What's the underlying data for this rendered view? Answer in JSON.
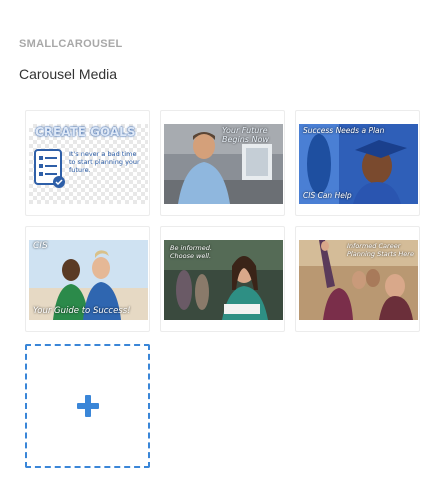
{
  "header": {
    "section_label": "SMALLCAROUSEL",
    "title": "Carousel Media"
  },
  "media_items": [
    {
      "name": "create-goals",
      "caption_main": "CREATE GOALS",
      "caption_sub": "It's never a bad time to start planning your future."
    },
    {
      "name": "your-future-begins-now",
      "caption_main": "Your Future Begins Now"
    },
    {
      "name": "success-needs-a-plan",
      "caption_main": "Success Needs a Plan",
      "caption_sub": "CIS Can Help"
    },
    {
      "name": "your-guide-to-success",
      "caption_main": "CIS",
      "caption_sub": "Your Guide to Success!"
    },
    {
      "name": "be-informed-choose-well",
      "caption_main": "Be informed. Choose well."
    },
    {
      "name": "informed-career-planning",
      "caption_main": "Informed Career Planning Starts Here"
    }
  ],
  "add_tile": {
    "icon": "plus-icon"
  },
  "colors": {
    "accent": "#3a86d8",
    "tile_border": "#ececec",
    "label_gray": "#a8a8a8"
  }
}
